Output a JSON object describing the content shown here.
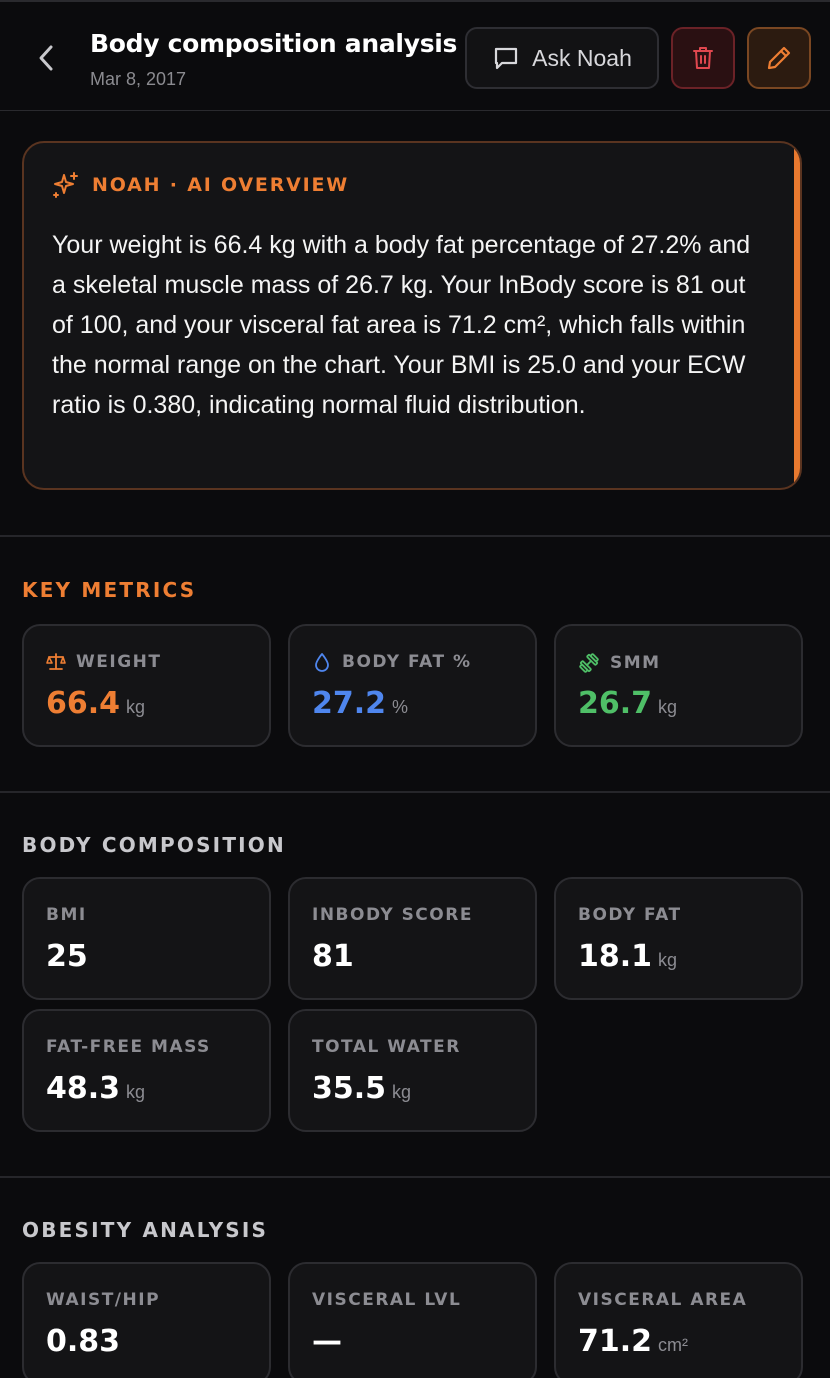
{
  "header": {
    "title": "Body composition analysis",
    "date": "Mar 8, 2017",
    "ask_label": "Ask Noah"
  },
  "ai_overview": {
    "label": "NOAH · AI OVERVIEW",
    "text": "Your weight is 66.4 kg with a body fat percentage of 27.2% and a skeletal muscle mass of 26.7 kg. Your InBody score is 81 out of 100, and your visceral fat area is 71.2 cm², which falls within the normal range on the chart. Your BMI is 25.0 and your ECW ratio is 0.380, indicating normal fluid distribution."
  },
  "key_metrics": {
    "title": "KEY METRICS",
    "items": [
      {
        "label": "WEIGHT",
        "value": "66.4",
        "unit": "kg",
        "icon": "scale-icon",
        "color": "#ee7e33"
      },
      {
        "label": "BODY FAT %",
        "value": "27.2",
        "unit": "%",
        "icon": "droplet-icon",
        "color": "#4f86ee"
      },
      {
        "label": "SMM",
        "value": "26.7",
        "unit": "kg",
        "icon": "dumbbell-icon",
        "color": "#4fbf67"
      }
    ]
  },
  "body_composition": {
    "title": "BODY COMPOSITION",
    "items": [
      {
        "label": "BMI",
        "value": "25",
        "unit": ""
      },
      {
        "label": "INBODY SCORE",
        "value": "81",
        "unit": ""
      },
      {
        "label": "BODY FAT",
        "value": "18.1",
        "unit": "kg"
      },
      {
        "label": "FAT-FREE MASS",
        "value": "48.3",
        "unit": "kg"
      },
      {
        "label": "TOTAL WATER",
        "value": "35.5",
        "unit": "kg"
      }
    ]
  },
  "obesity_analysis": {
    "title": "OBESITY ANALYSIS",
    "items": [
      {
        "label": "WAIST/HIP",
        "value": "0.83",
        "unit": ""
      },
      {
        "label": "VISCERAL LVL",
        "value": "—",
        "unit": ""
      },
      {
        "label": "VISCERAL AREA",
        "value": "71.2",
        "unit": "cm²"
      }
    ]
  },
  "colors": {
    "accent": "#ee7e33",
    "blue": "#4f86ee",
    "green": "#4fbf67",
    "danger": "#e0474f"
  }
}
